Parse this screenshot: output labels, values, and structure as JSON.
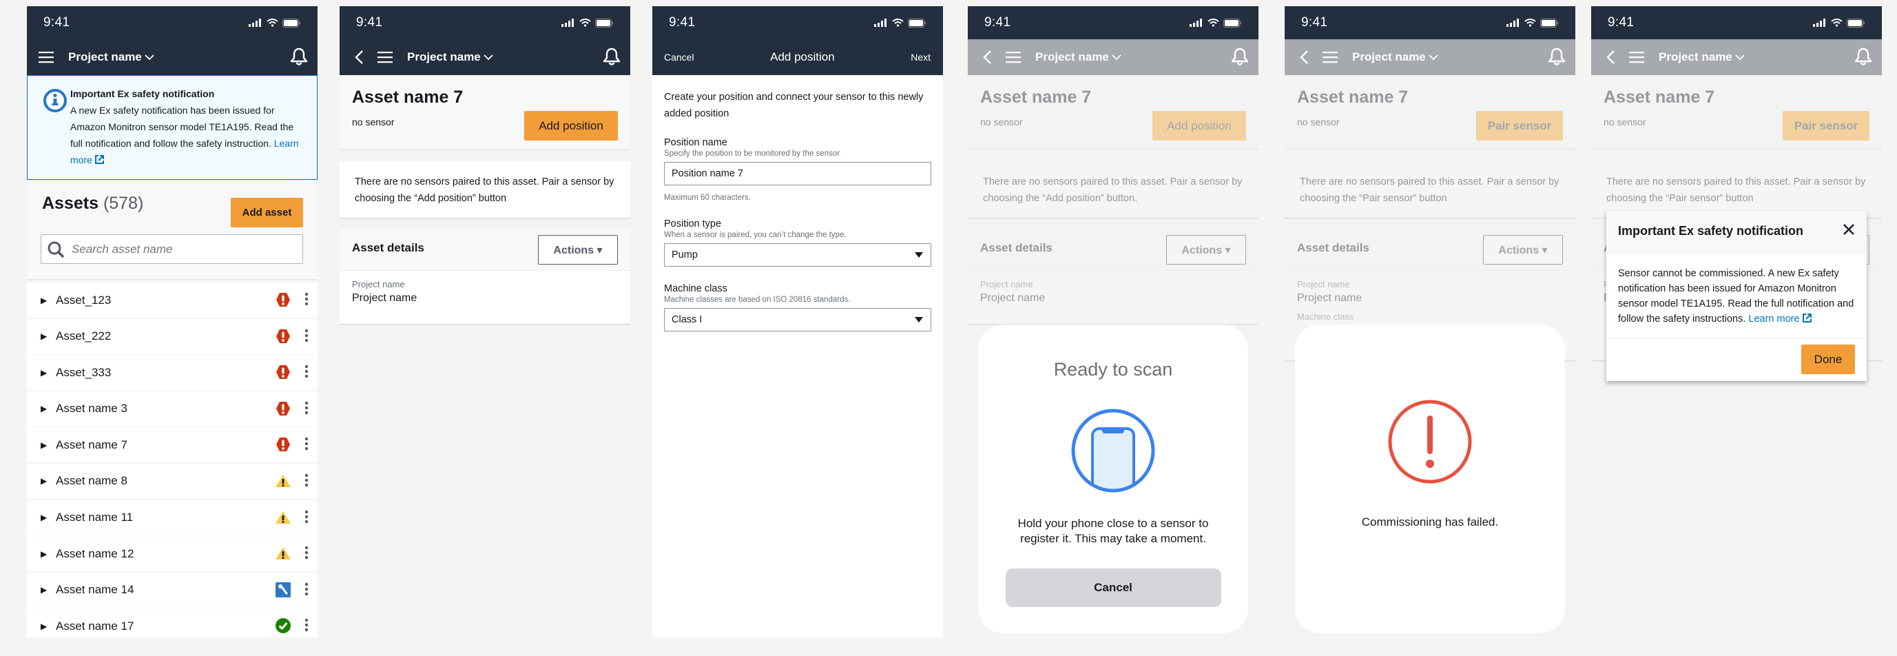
{
  "status_bar": {
    "time": "9:41"
  },
  "nav": {
    "project_name": "Project name"
  },
  "screen1": {
    "flash": {
      "title": "Important Ex safety notification",
      "body": "A new Ex safety notification has been issued for Amazon Monitron sensor model TE1A195. Read the full notification and follow the safety instruction.",
      "link": "Learn more"
    },
    "assets_title": "Assets",
    "assets_count": "(578)",
    "add_asset": "Add asset",
    "search_placeholder": "Search asset name",
    "assets": [
      {
        "name": "Asset_123",
        "status": "critical"
      },
      {
        "name": "Asset_222",
        "status": "critical"
      },
      {
        "name": "Asset_333",
        "status": "critical"
      },
      {
        "name": "Asset name 3",
        "status": "critical"
      },
      {
        "name": "Asset name 7",
        "status": "critical"
      },
      {
        "name": "Asset name 8",
        "status": "warning"
      },
      {
        "name": "Asset name 11",
        "status": "warning"
      },
      {
        "name": "Asset name 12",
        "status": "warning"
      },
      {
        "name": "Asset name 14",
        "status": "maintenance"
      },
      {
        "name": "Asset name 17",
        "status": "healthy"
      }
    ],
    "status_colors": {
      "critical": "#d13212",
      "warning": "#f7c948",
      "maintenance": "#2f78c4",
      "healthy": "#1d8102"
    }
  },
  "asset": {
    "name": "Asset name 7",
    "sensor_status": "no sensor",
    "add_position": "Add position",
    "pair_sensor": "Pair sensor",
    "msg_add_position": "There are no sensors paired to this asset. Pair a sensor by choosing the “Add position” button",
    "msg_add_position_period": "There are no sensors paired to this asset. Pair a sensor by choosing the “Add position” button.",
    "msg_pair_sensor": "There are no sensors paired to this asset. Pair a sensor by choosing the “Pair sensor” button",
    "details_title": "Asset details",
    "actions": "Actions",
    "project_label": "Project name",
    "project_value": "Project name",
    "machine_hint": "Machine class"
  },
  "form": {
    "cancel": "Cancel",
    "title": "Add position",
    "next": "Next",
    "intro": "Create your position and connect your sensor to this newly added position",
    "position_name_label": "Position name",
    "position_name_desc": "Specify the position to be monitored by the sensor",
    "position_name_value": "Position name 7",
    "position_name_constraint": "Maximum 60 characters.",
    "position_type_label": "Position type",
    "position_type_desc": "When a sensor is paired, you can’t change the type.",
    "position_type_value": "Pump",
    "machine_class_label": "Machine class",
    "machine_class_desc": "Machine classes are based on ISO 20816 standards.",
    "machine_class_value": "Class I"
  },
  "scan": {
    "title": "Ready to scan",
    "text": "Hold your phone close to a sensor to register it. This may take a moment.",
    "cancel": "Cancel"
  },
  "failed": {
    "text": "Commissioning has failed."
  },
  "modal": {
    "title": "Important Ex safety notification",
    "body": "Sensor cannot be commissioned. A new Ex safety notification has been issued for Amazon Monitron sensor model TE1A195. Read the full notification and follow the safety instructions.",
    "link": "Learn more",
    "done": "Done"
  }
}
